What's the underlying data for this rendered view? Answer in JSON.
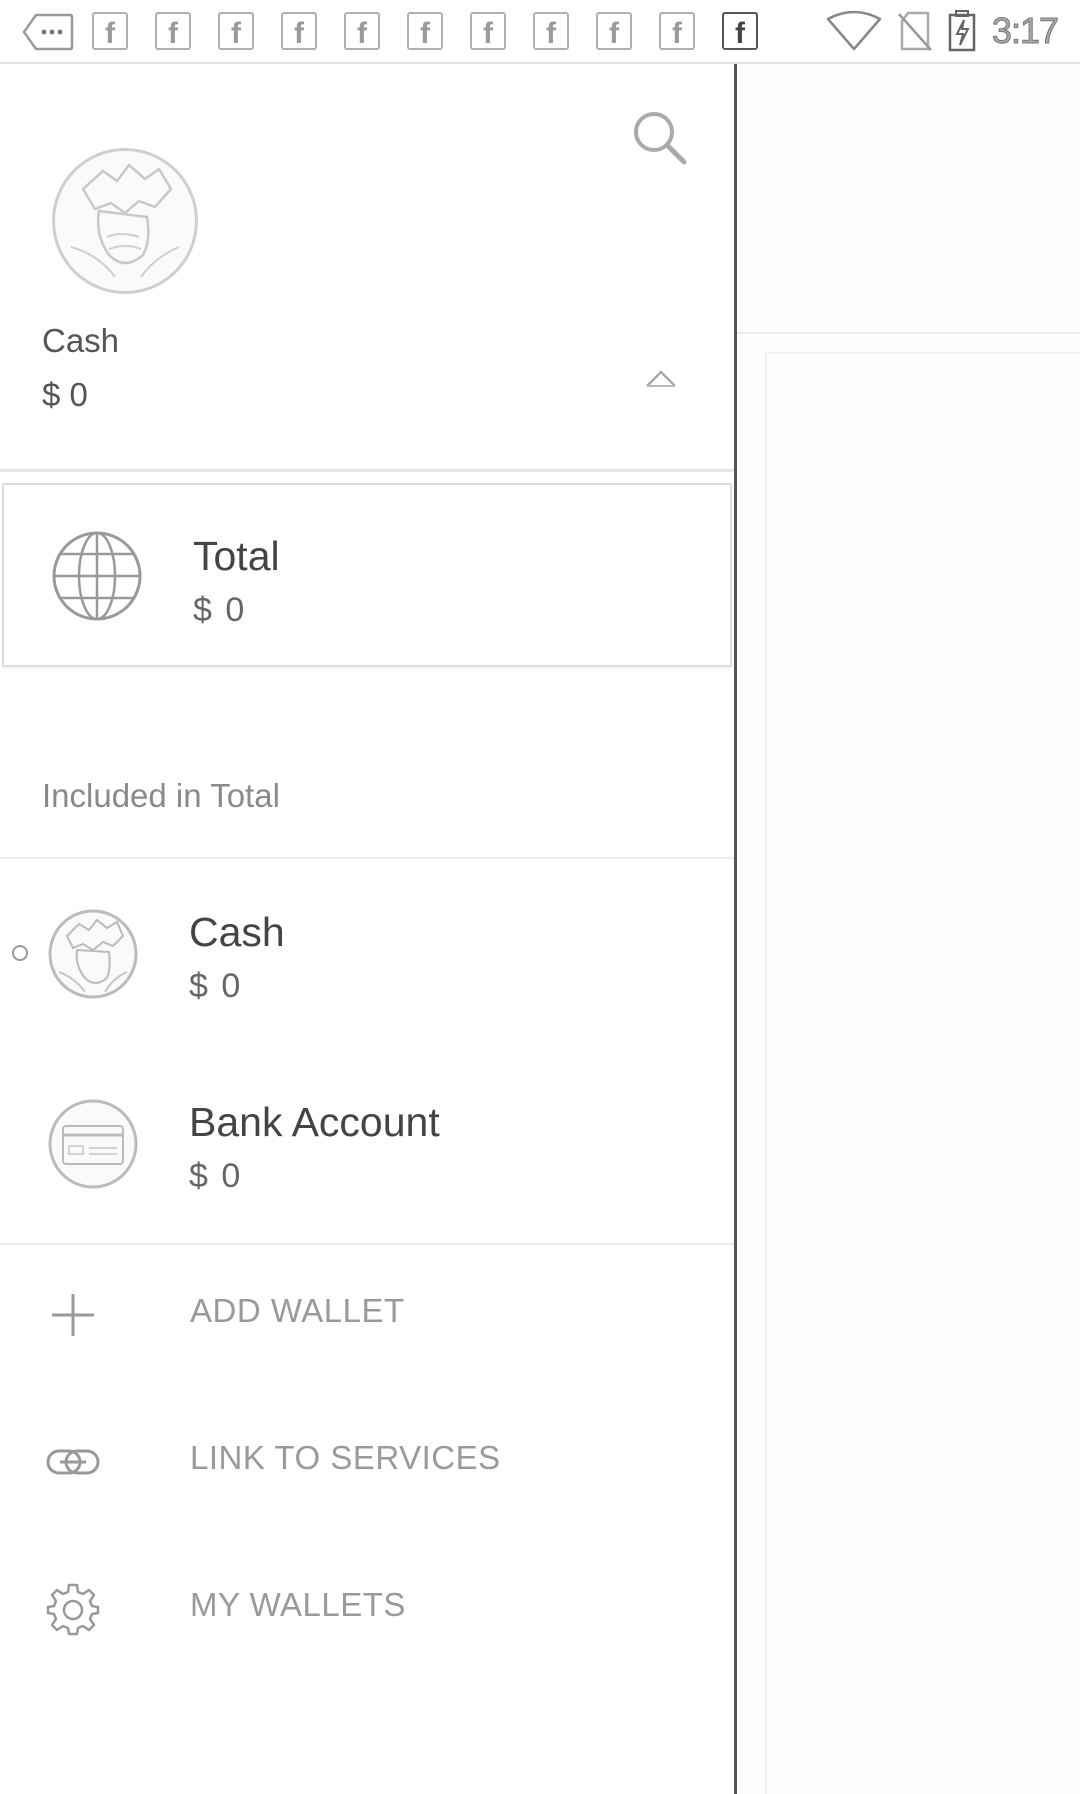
{
  "status_bar": {
    "time": "3:17",
    "notification_icons": [
      "more-icon",
      "facebook-icon",
      "facebook-icon",
      "facebook-icon",
      "facebook-icon",
      "facebook-icon",
      "facebook-icon",
      "facebook-icon",
      "facebook-icon",
      "facebook-icon",
      "facebook-icon",
      "facebook-icon"
    ],
    "system_icons": [
      "wifi-icon",
      "no-sim-icon",
      "battery-charging-icon"
    ]
  },
  "drawer": {
    "header": {
      "wallet_name": "Cash",
      "wallet_amount": "$ 0",
      "icon": "cash-icon"
    },
    "total": {
      "title": "Total",
      "amount": "$ 0",
      "icon": "globe-icon"
    },
    "section_label": "Included in Total",
    "wallets": [
      {
        "name": "Cash",
        "amount": "$ 0",
        "icon": "cash-icon",
        "selected": true
      },
      {
        "name": "Bank Account",
        "amount": "$ 0",
        "icon": "bank-card-icon",
        "selected": false
      }
    ],
    "actions": [
      {
        "label": "ADD WALLET",
        "icon": "plus-icon"
      },
      {
        "label": "LINK TO SERVICES",
        "icon": "link-icon"
      },
      {
        "label": "MY WALLETS",
        "icon": "gear-icon"
      }
    ]
  },
  "colors": {
    "drawer_background": "#ffffff",
    "text_primary": "#444444",
    "text_secondary": "#9a9a9a",
    "divider": "#e6e6e6"
  }
}
